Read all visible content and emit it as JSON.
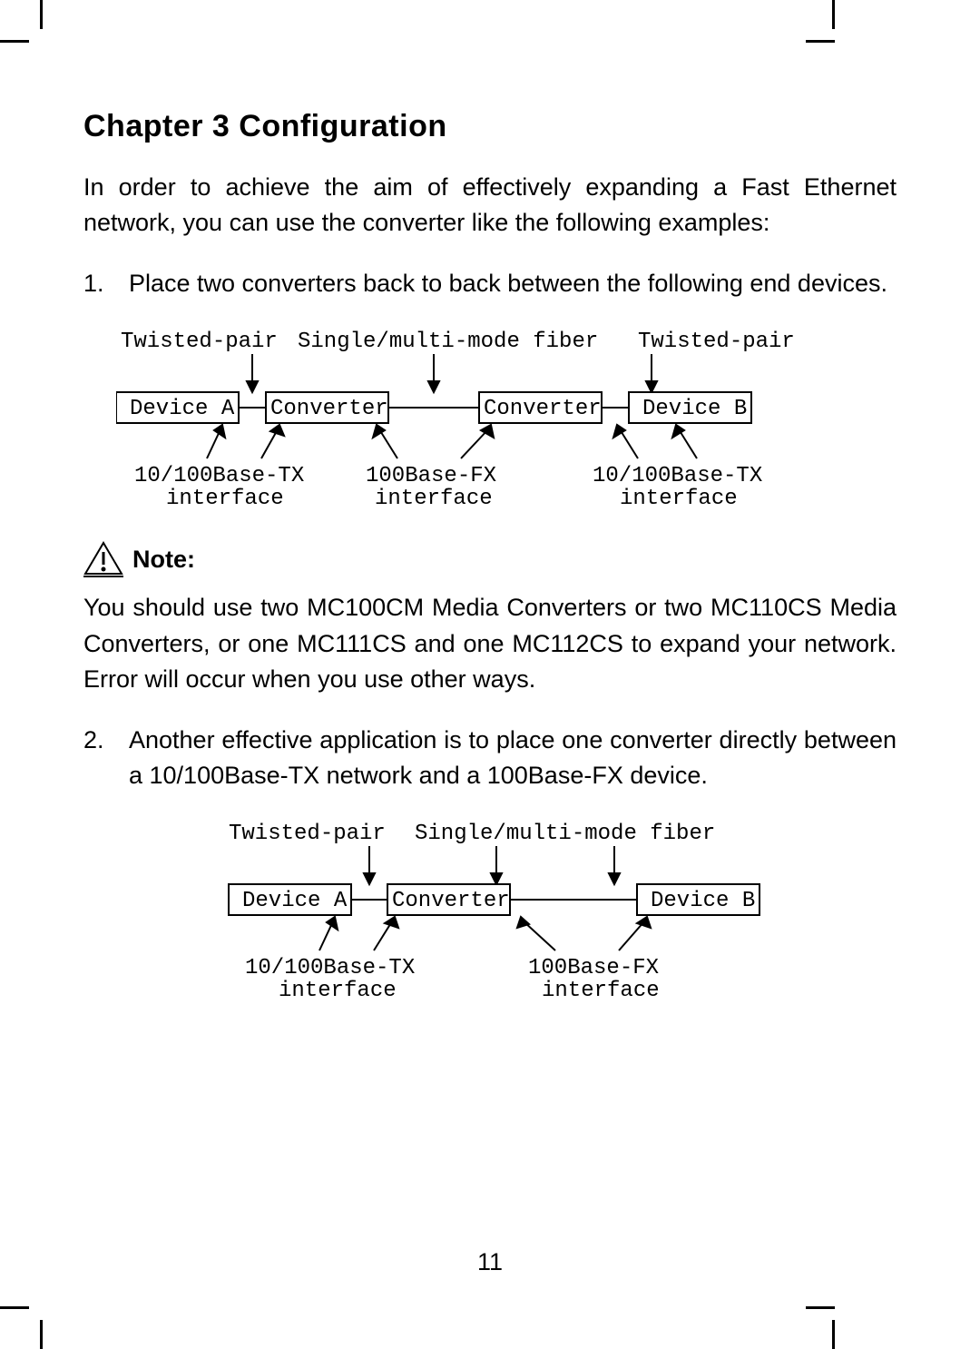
{
  "chapter_title": "Chapter 3   Configuration",
  "intro": "In order to achieve the aim of effectively expanding a Fast Ethernet network, you can use the converter like the following examples:",
  "items": [
    {
      "num": "1.",
      "text": "Place two converters back to back between the following end devices."
    },
    {
      "num": "2.",
      "text": "Another effective application is to place one converter directly between a 10/100Base-TX network and a 100Base-FX device."
    }
  ],
  "note_label": "Note:",
  "note_text": "You should use two MC100CM Media Converters or two MC110CS Media Converters, or one MC111CS and one MC112CS to expand your network. Error will occur when you use other ways.",
  "diagram1": {
    "top_labels": [
      "Twisted-pair",
      "Single/multi-mode fiber",
      "Twisted-pair"
    ],
    "boxes": [
      "Device A",
      "Converter",
      "Converter",
      "Device B"
    ],
    "bottom_labels": [
      "10/100Base-TX interface",
      "100Base-FX interface",
      "10/100Base-TX interface"
    ]
  },
  "diagram2": {
    "top_labels": [
      "Twisted-pair",
      "Single/multi-mode fiber"
    ],
    "boxes": [
      "Device A",
      "Converter",
      "Device B"
    ],
    "bottom_labels": [
      "10/100Base-TX interface",
      "100Base-FX interface"
    ]
  },
  "page_number": "11"
}
